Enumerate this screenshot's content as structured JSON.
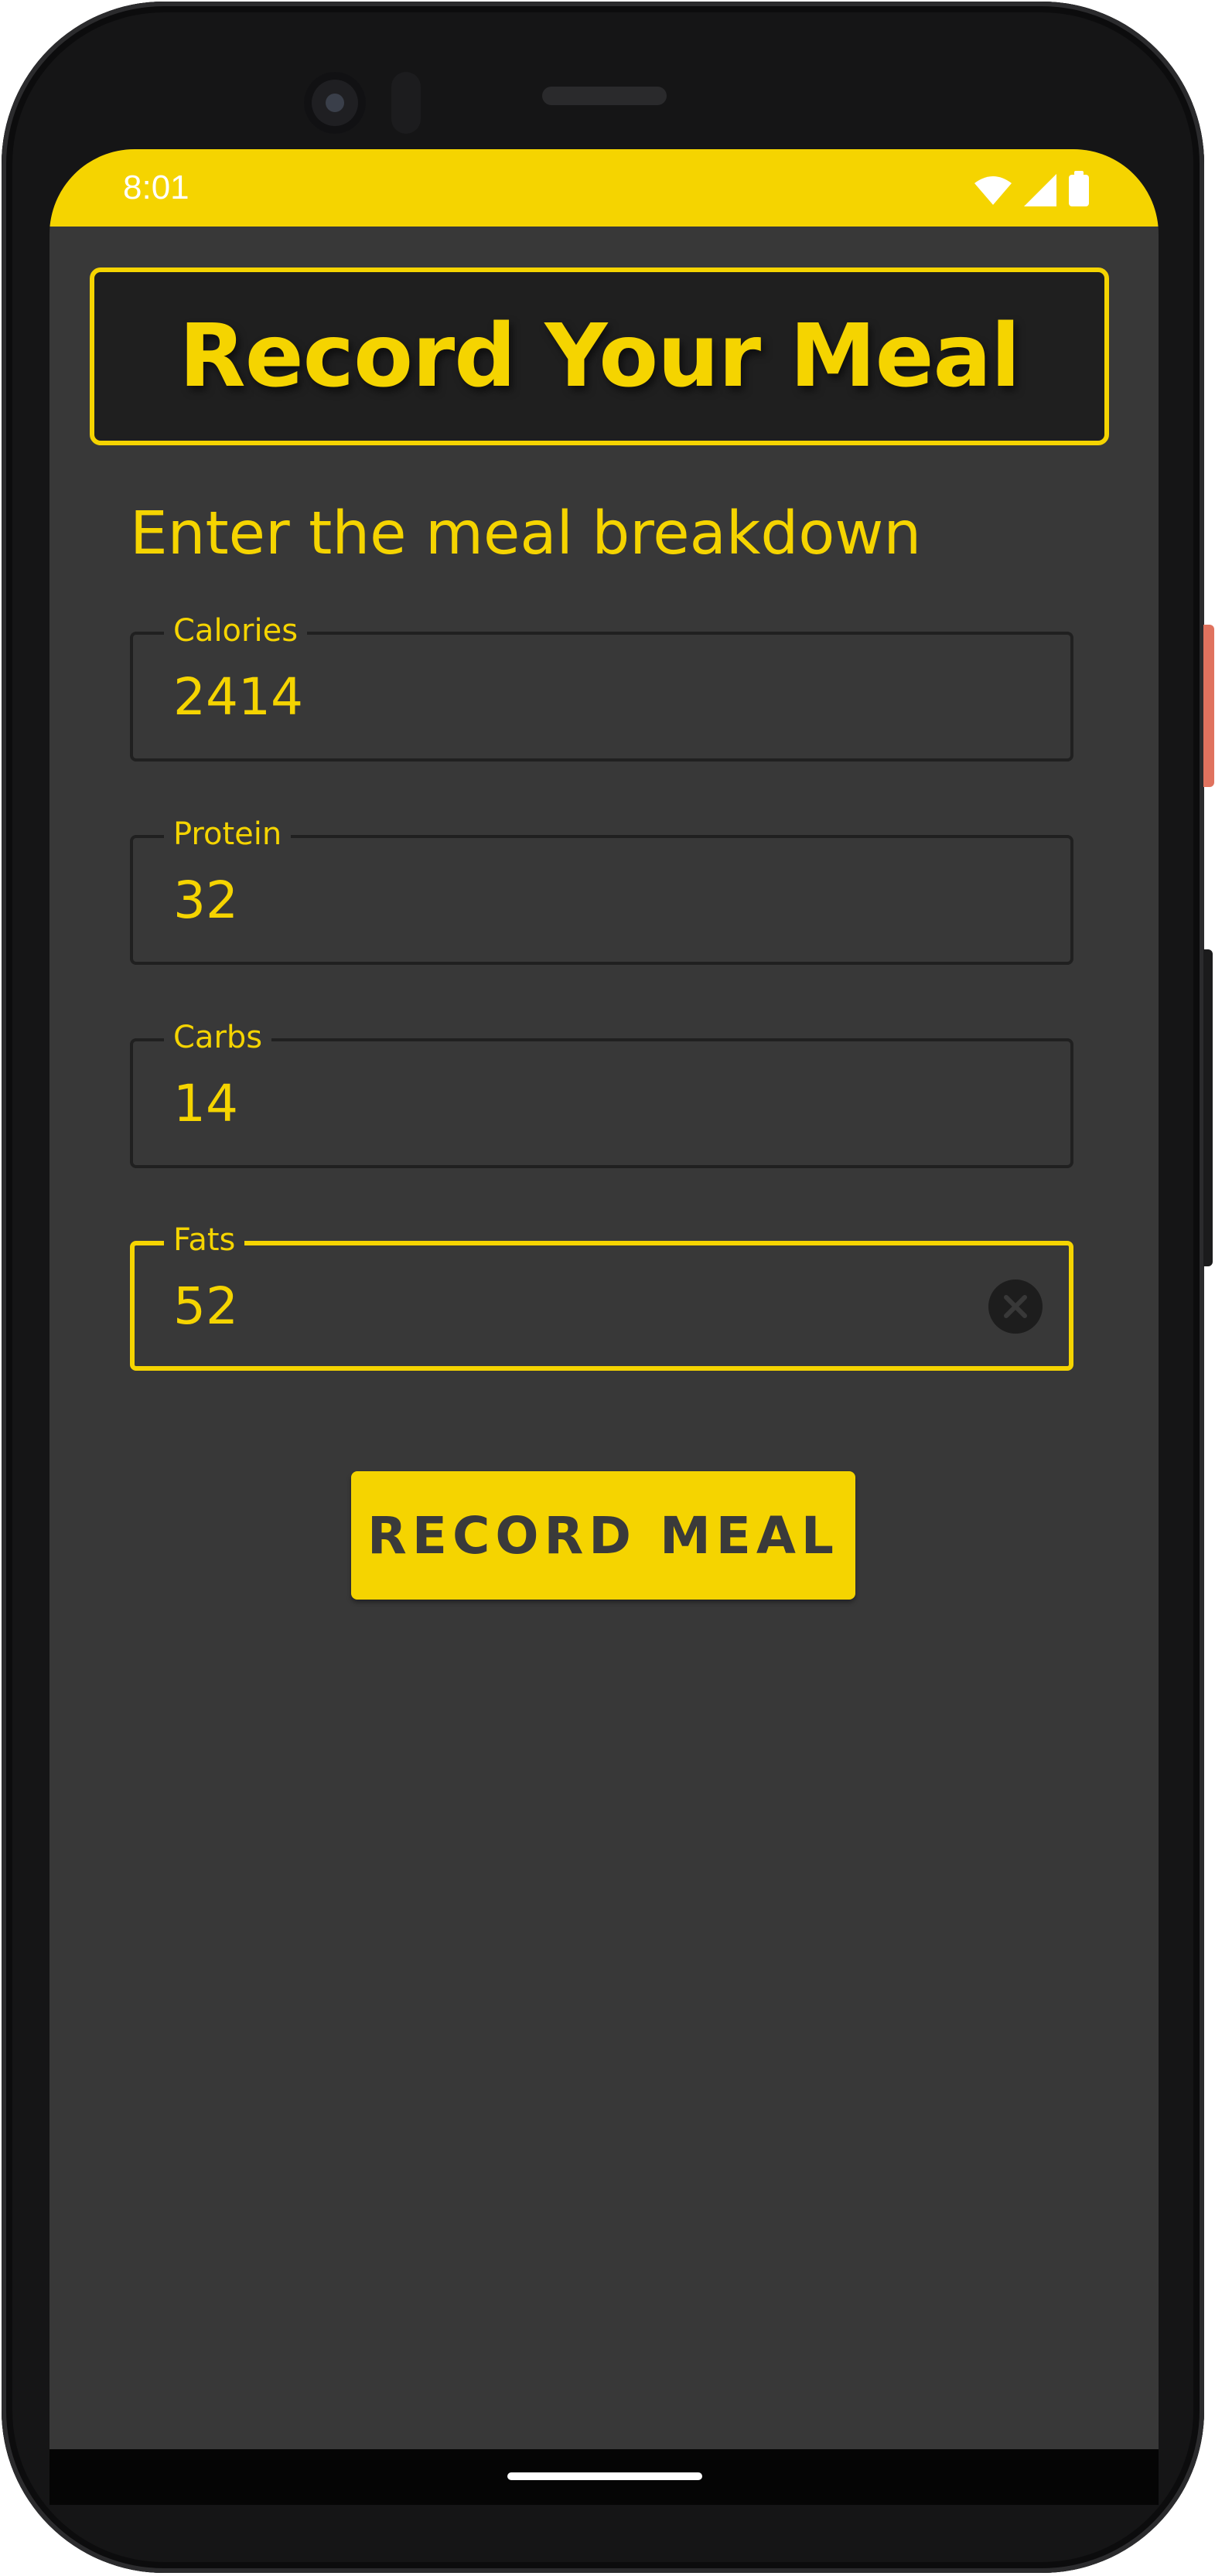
{
  "status_bar": {
    "time": "8:01",
    "icons": [
      "wifi-icon",
      "cellular-signal-icon",
      "battery-icon"
    ]
  },
  "app_bar": {
    "title": "Record Your Meal"
  },
  "form": {
    "heading": "Enter the meal breakdown",
    "fields": [
      {
        "label": "Calories",
        "value": "2414"
      },
      {
        "label": "Protein",
        "value": "32"
      },
      {
        "label": "Carbs",
        "value": "14"
      },
      {
        "label": "Fats",
        "value": "52",
        "focused": true
      }
    ],
    "submit_label": "RECORD MEAL"
  },
  "colors": {
    "accent": "#f5d400",
    "background": "#383838",
    "title_background": "#1f1f1f",
    "button_text": "#3a3a3a"
  }
}
